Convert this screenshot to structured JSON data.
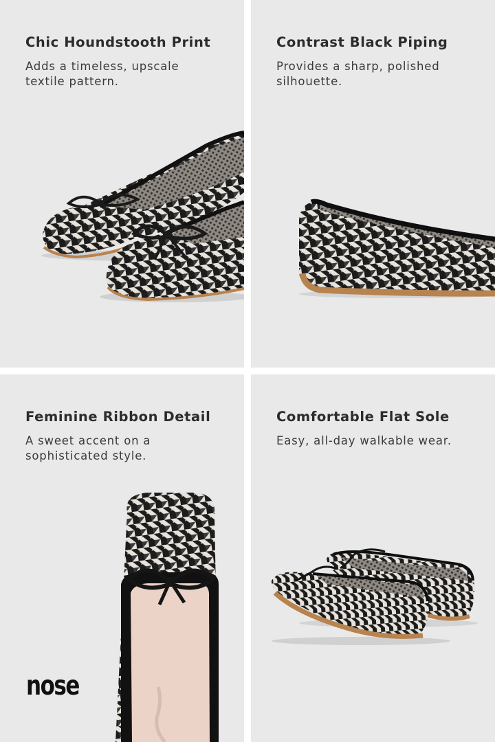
{
  "panels": [
    {
      "title": "Chic Houndstooth Print",
      "desc_lines": [
        "Adds a timeless, upscale",
        "textile pattern."
      ]
    },
    {
      "title": "Contrast Black Piping",
      "desc_lines": [
        "Provides a sharp, polished",
        "silhouette."
      ]
    },
    {
      "title": "Feminine Ribbon Detail",
      "desc_lines": [
        "A sweet accent on a",
        "sophisticated style."
      ]
    },
    {
      "title": "Comfortable Flat Sole",
      "desc_lines": [
        "Easy, all-day walkable wear."
      ]
    }
  ],
  "brand": {
    "logo_text": "nose"
  },
  "colors": {
    "panel_bg": "#e9e9ea",
    "houndstooth_dark": "#1c1c1c",
    "houndstooth_light": "#e7e3dc",
    "sole_tan": "#b7834f",
    "insole_pink": "#ecd3c8"
  }
}
